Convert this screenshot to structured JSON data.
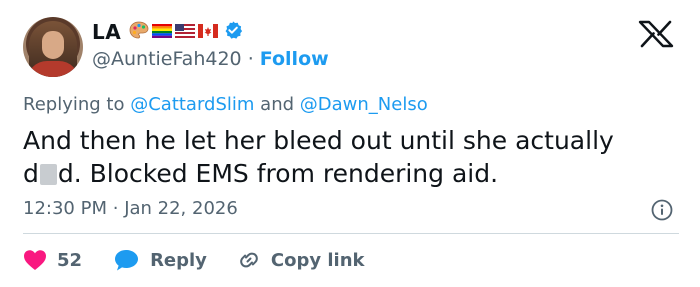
{
  "author": {
    "name": "LA",
    "handle": "@AuntieFah420",
    "separator": "·",
    "follow_label": "Follow",
    "verified": true,
    "name_emojis": [
      "artist-palette",
      "rainbow-flag",
      "us-flag",
      "canada-flag"
    ]
  },
  "replying": {
    "prefix": "Replying to",
    "mention_1": "@CattardSlim",
    "conjunction": "and",
    "mention_2": "@Dawn_Nelso"
  },
  "tweet": {
    "line1": "And then he let her bleed out until she actually",
    "word_start": "d",
    "word_end": "d. Blocked EMS from rendering aid."
  },
  "meta": {
    "time": "12:30 PM",
    "separator": "·",
    "date": "Jan 22, 2026"
  },
  "actions": {
    "like_count": "52",
    "reply_label": "Reply",
    "copy_label": "Copy link"
  },
  "colors": {
    "accent": "#1d9bf0",
    "like": "#f91880",
    "text": "#0f1419",
    "muted": "#536471"
  },
  "icons": [
    "x-logo-icon",
    "verified-badge-icon",
    "info-icon",
    "heart-icon",
    "reply-bubble-icon",
    "link-icon"
  ]
}
